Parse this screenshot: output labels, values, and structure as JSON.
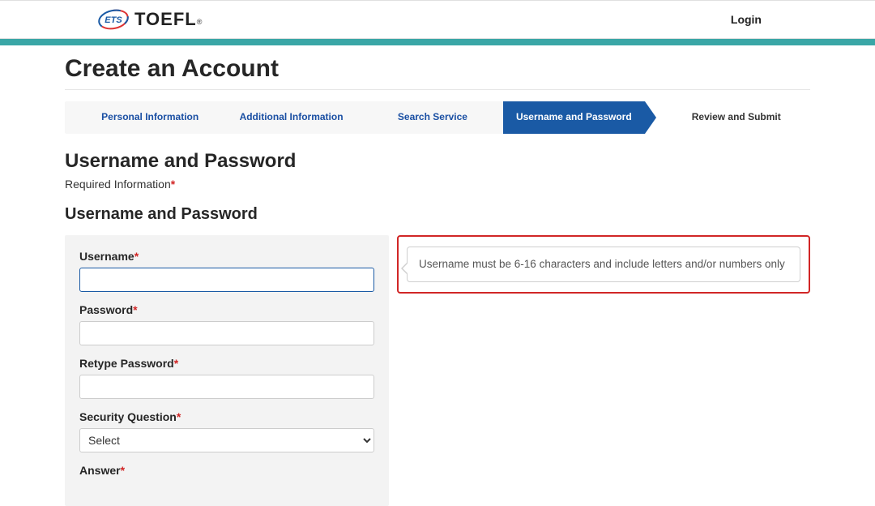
{
  "header": {
    "logo_ets": "ETS",
    "logo_toefl": "TOEFL",
    "logo_reg": "®",
    "login_label": "Login"
  },
  "page": {
    "title": "Create an Account"
  },
  "stepper": {
    "steps": [
      "Personal Information",
      "Additional Information",
      "Search Service",
      "Username and Password",
      "Review and Submit"
    ]
  },
  "section": {
    "heading_main": "Username and Password",
    "required_label": "Required Information",
    "heading_sub": "Username and Password"
  },
  "form": {
    "username_label": "Username",
    "password_label": "Password",
    "retype_label": "Retype Password",
    "secq_label": "Security Question",
    "secq_selected": "Select",
    "answer_label": "Answer"
  },
  "hint": {
    "text": "Username must be 6-16 characters and include letters and/or numbers only"
  }
}
